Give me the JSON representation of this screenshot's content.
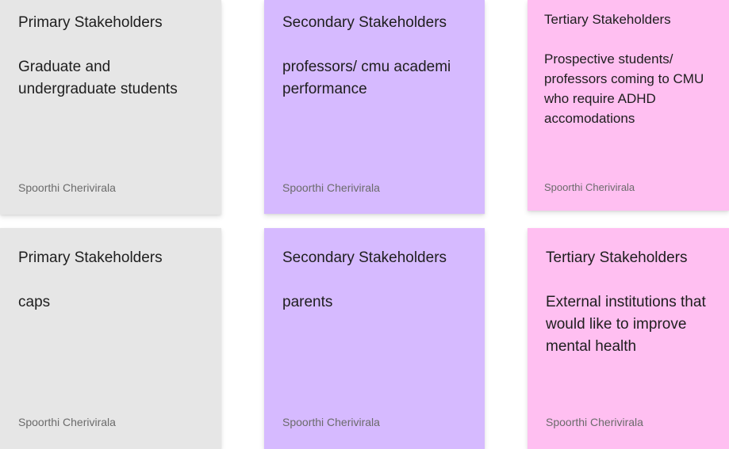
{
  "board": {
    "notes": [
      {
        "title": "Primary Stakeholders",
        "body": "Graduate and\nundergraduate students",
        "author": "Spoorthi Cherivirala",
        "color": "#e6e6e6"
      },
      {
        "title": "Secondary Stakeholders",
        "body": "professors/ cmu academi\nperformance",
        "author": "Spoorthi Cherivirala",
        "color": "#d6baff"
      },
      {
        "title": "Tertiary Stakeholders",
        "body": "Prospective students/\nprofessors coming to CMU\nwho require ADHD\naccomodations",
        "author": "Spoorthi Cherivirala",
        "color": "#ffbff1"
      },
      {
        "title": "Primary Stakeholders",
        "body": "caps",
        "author": "Spoorthi Cherivirala",
        "color": "#e6e6e6"
      },
      {
        "title": "Secondary Stakeholders",
        "body": "parents",
        "author": "Spoorthi Cherivirala",
        "color": "#d6baff"
      },
      {
        "title": "Tertiary Stakeholders",
        "body": "External institutions that\nwould like to improve\nmental health",
        "author": "Spoorthi Cherivirala",
        "color": "#ffbff1"
      }
    ]
  }
}
